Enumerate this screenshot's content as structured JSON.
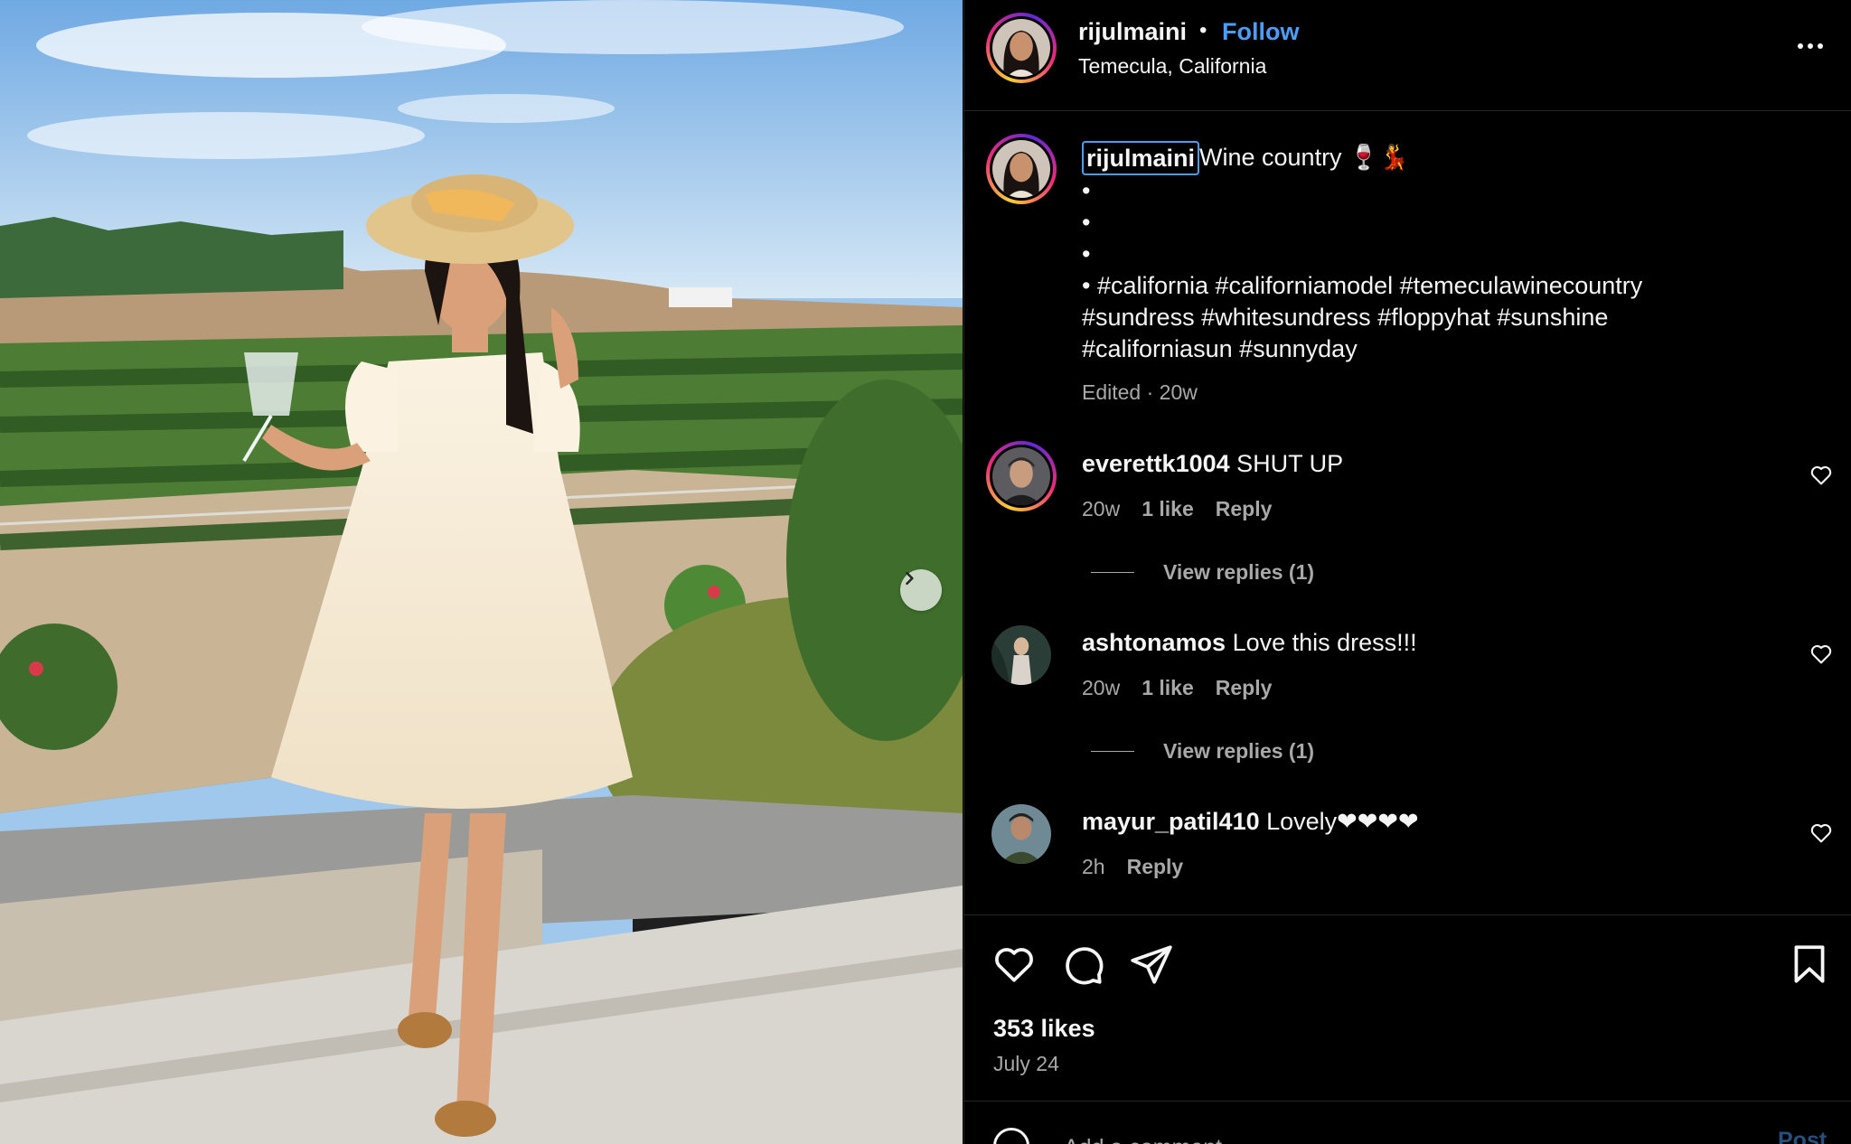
{
  "post": {
    "photo_alt": "",
    "next_icon": "chevron-right-icon"
  },
  "header": {
    "username": "rijulmaini",
    "separator": "•",
    "follow_label": "Follow",
    "location": "Temecula, California",
    "more_icon": "more-horizontal-icon"
  },
  "caption": {
    "username": "rijulmaini",
    "text": "Wine country 🍷💃",
    "lines": [
      "•",
      "•",
      "•",
      "• #california #californiamodel #temeculawinecountry",
      "#sundress #whitesundress #floppyhat #sunshine",
      "#californiasun #sunnyday"
    ],
    "meta": "Edited · 20w"
  },
  "comments": [
    {
      "username": "everettk1004",
      "text": "SHUT UP",
      "age": "20w",
      "likes": "1 like",
      "reply_label": "Reply",
      "view_replies": "View replies (1)"
    },
    {
      "username": "ashtonamos",
      "text": "Love this dress!!!",
      "age": "20w",
      "likes": "1 like",
      "reply_label": "Reply",
      "view_replies": "View replies (1)"
    },
    {
      "username": "mayur_patil410",
      "text": "Lovely❤❤❤❤",
      "age": "2h",
      "reply_label": "Reply"
    }
  ],
  "actions": {
    "like_icon": "heart-icon",
    "comment_icon": "comment-icon",
    "share_icon": "send-icon",
    "save_icon": "bookmark-icon"
  },
  "footer": {
    "likes": "353 likes",
    "date": "July 24",
    "add_comment_placeholder": "Add a comment…",
    "post_label": "Post"
  },
  "colors": {
    "accent": "#4a9df8",
    "background": "#000000",
    "muted": "#a8a8a8"
  }
}
